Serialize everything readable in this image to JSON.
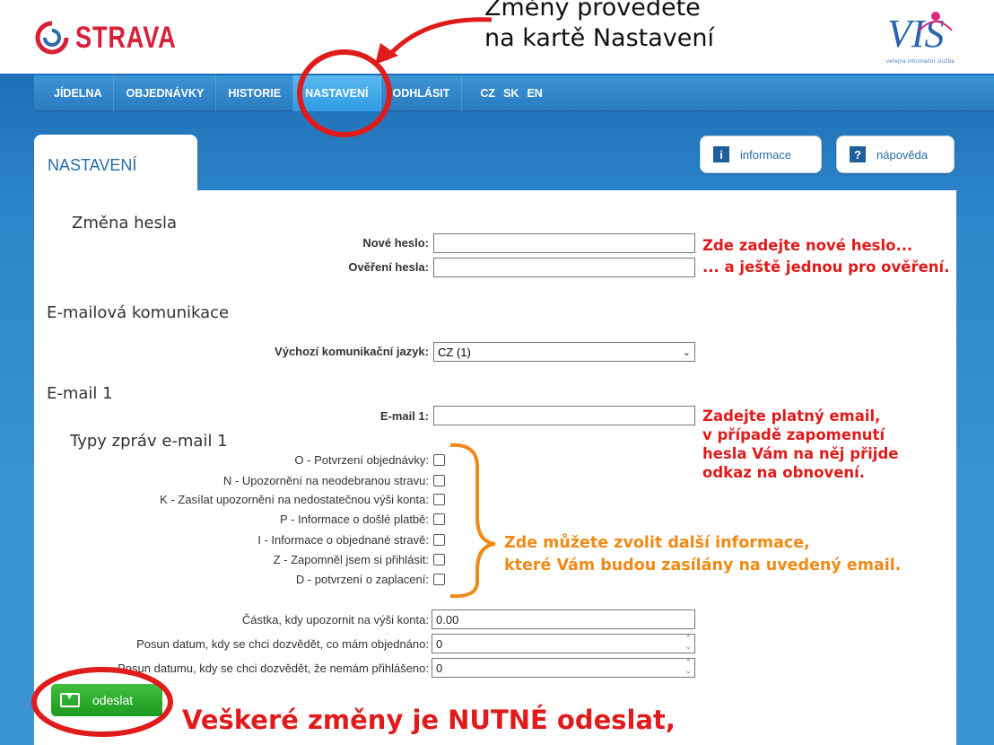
{
  "brand": {
    "name": "STRAVA",
    "partner_logo_text": "VIS",
    "partner_subtitle": "veřejná informační služba"
  },
  "callout_top": {
    "line1": "Změny provedete",
    "line2": "na kartě Nastavení"
  },
  "nav": {
    "items": [
      "JÍDELNA",
      "OBJEDNÁVKY",
      "HISTORIE",
      "NASTAVENÍ",
      "ODHLÁSIT"
    ],
    "active": "NASTAVENÍ",
    "languages": [
      "CZ",
      "SK",
      "EN"
    ]
  },
  "panel": {
    "tab_title": "NASTAVENÍ",
    "info_button": "informace",
    "help_button": "nápověda",
    "info_icon": "i",
    "help_icon": "?"
  },
  "password": {
    "section_title": "Změna hesla",
    "new_label": "Nové heslo:",
    "confirm_label": "Ověření hesla:",
    "new_value": "",
    "confirm_value": ""
  },
  "email_comm": {
    "section_title": "E-mailová komunikace",
    "language_label": "Výchozí komunikační jazyk:",
    "language_value": "CZ (1)"
  },
  "email1": {
    "section_title": "E-mail 1",
    "email_label": "E-mail 1:",
    "email_value": "",
    "types_title": "Typy zpráv e-mail 1",
    "types": [
      "O - Potvrzení objednávky:",
      "N - Upozornění na neodebranou stravu:",
      "K - Zasílat upozornění na nedostatečnou výši konta:",
      "P - Informace o došlé platbě:",
      "I - Informace o objednané stravě:",
      "Z - Zapomněl jsem si přihlásit:",
      "D - potvrzení o zaplacení:"
    ]
  },
  "extra": {
    "amount_label": "Částka, kdy upozornit na výši konta:",
    "amount_value": "0.00",
    "shift_ordered_label": "Posun datum, kdy se chci dozvědět, co mám objednáno:",
    "shift_ordered_value": "0",
    "shift_unregistered_label": "Posun datumu, kdy se chci dozvědět, že nemám přihlášeno:",
    "shift_unregistered_value": "0"
  },
  "send_button": "odeslat",
  "annotations": {
    "pw_note_1": "Zde zadejte nové heslo...",
    "pw_note_2": "... a ještě jednou pro ověření.",
    "email_note": [
      "Zadejte platný email,",
      "v případě zapomenutí",
      "hesla Vám na něj přijde",
      "odkaz na obnovení."
    ],
    "types_note": [
      "Zde můžete zvolit další informace,",
      "které Vám budou zasílány na uvedený email."
    ],
    "bottom_note": "Veškeré změny je NUTNÉ odeslat,"
  },
  "colors": {
    "brand_red": "#d8203a",
    "nav_blue": "#2a7bc0",
    "annotation_red": "#e01b1b",
    "annotation_orange": "#f08a16",
    "send_green": "#2aa82a"
  }
}
